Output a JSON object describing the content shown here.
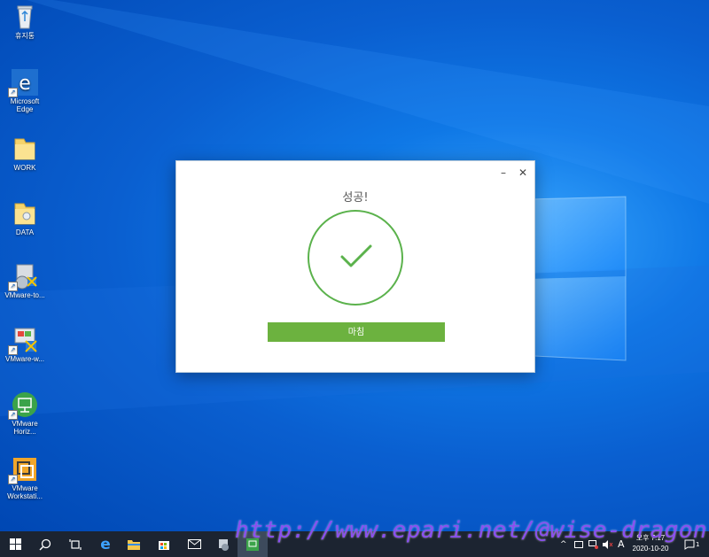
{
  "desktop": {
    "icons": [
      {
        "label": "휴지통",
        "icon": "recycle-bin-icon"
      },
      {
        "label": "Microsoft Edge",
        "icon": "edge-icon"
      },
      {
        "label": "WORK",
        "icon": "folder-icon"
      },
      {
        "label": "DATA",
        "icon": "folder-icon"
      },
      {
        "label": "VMware-to...",
        "icon": "installer-icon"
      },
      {
        "label": "VMware-w...",
        "icon": "installer-icon"
      },
      {
        "label": "VMware Horiz...",
        "icon": "vmware-horizon-icon"
      },
      {
        "label": "VMware Workstati...",
        "icon": "vmware-workstation-icon"
      }
    ]
  },
  "dialog": {
    "title": "성공!",
    "minimize_glyph": "–",
    "close_glyph": "✕",
    "finish_button": "마침",
    "accent_color": "#6cb23f"
  },
  "taskbar": {
    "tray_input_indicator": "A",
    "date": "2020-10-20",
    "time": "오후 7:17",
    "notification_count": "1"
  },
  "watermark": "http://www.epari.net/@wise-dragon"
}
